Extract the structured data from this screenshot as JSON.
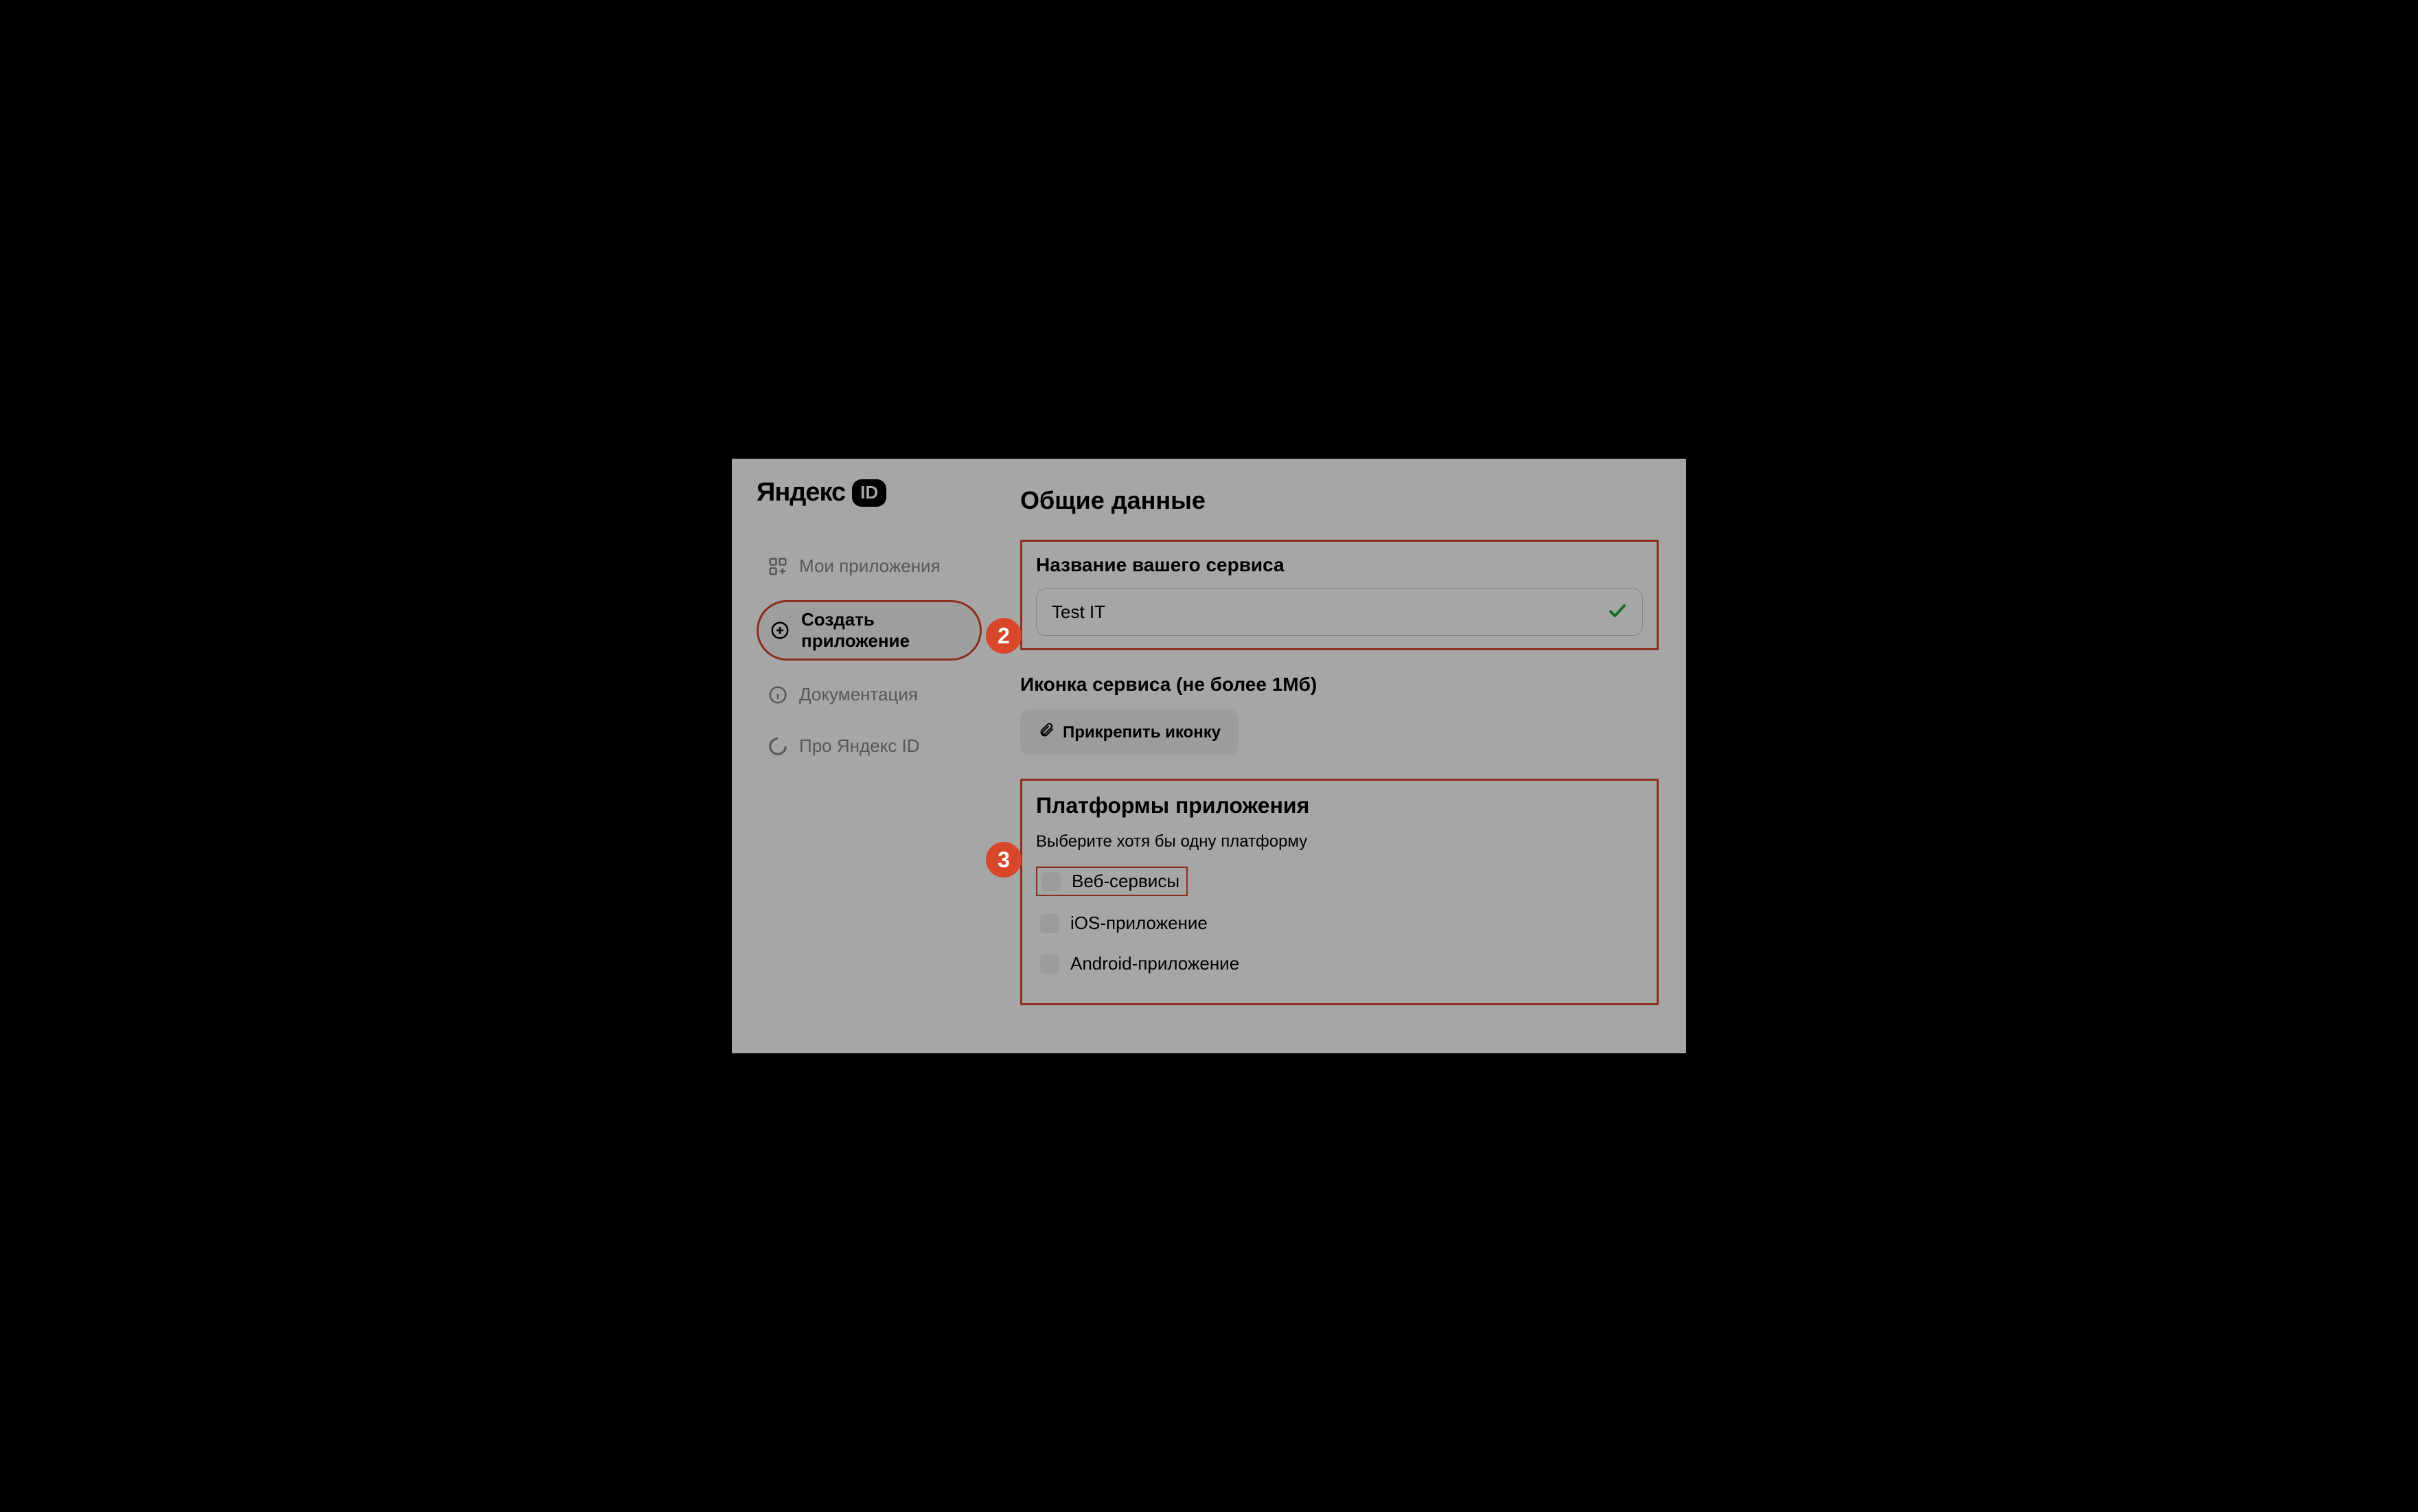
{
  "logo": {
    "text": "Яндекс",
    "badge": "ID"
  },
  "sidebar": {
    "items": [
      {
        "label": "Мои приложения"
      },
      {
        "label": "Создать приложение"
      },
      {
        "label": "Документация"
      },
      {
        "label": "Про Яндекс ID"
      }
    ]
  },
  "main": {
    "section_title": "Общие данные",
    "service_name_label": "Название вашего сервиса",
    "service_name_value": "Test IT",
    "icon_label": "Иконка сервиса (не более 1Мб)",
    "attach_button": "Прикрепить иконку",
    "platforms_title": "Платформы приложения",
    "platforms_hint": "Выберите хотя бы одну платформу",
    "platforms": [
      {
        "label": "Веб-сервисы"
      },
      {
        "label": "iOS-приложение"
      },
      {
        "label": "Android-приложение"
      }
    ]
  },
  "annotations": {
    "step2": "2",
    "step3": "3"
  }
}
